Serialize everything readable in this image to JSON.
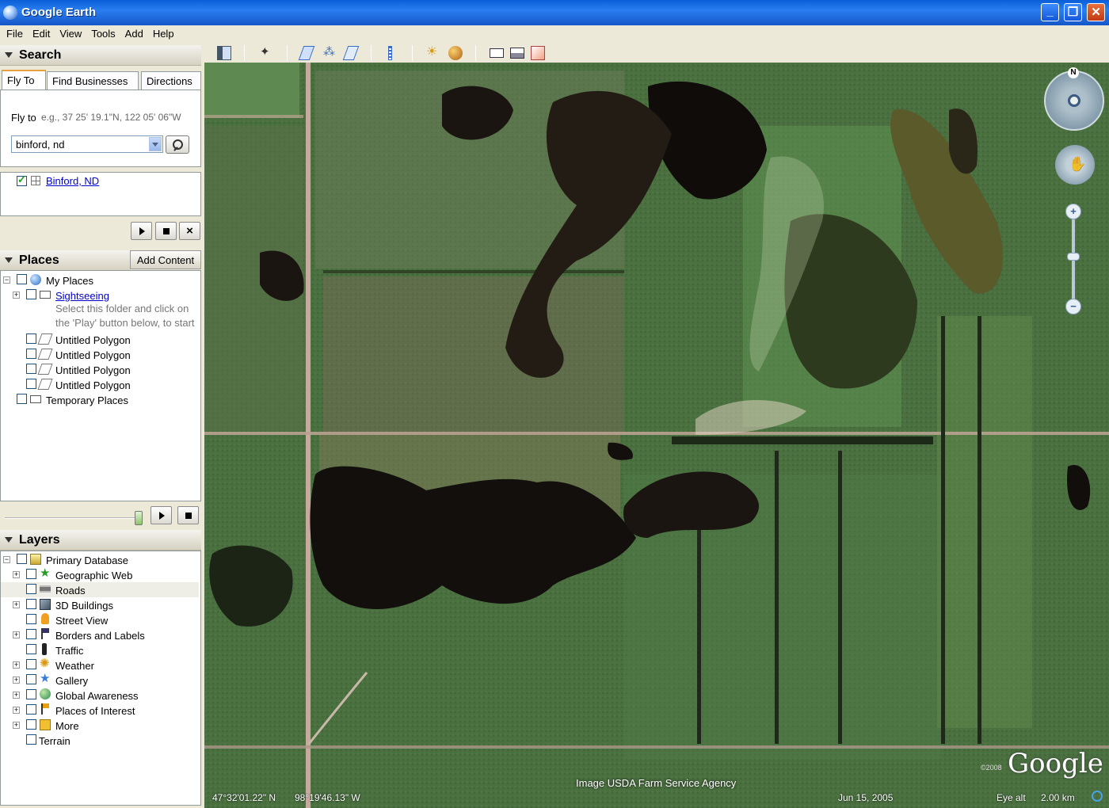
{
  "window": {
    "title": "Google Earth"
  },
  "menu": [
    "File",
    "Edit",
    "View",
    "Tools",
    "Add",
    "Help"
  ],
  "search": {
    "header": "Search",
    "tabs": [
      "Fly To",
      "Find Businesses",
      "Directions"
    ],
    "flyto_label": "Fly to",
    "flyto_hint": "e.g., 37 25' 19.1\"N, 122 05' 06\"W",
    "query": "binford, nd",
    "result": "Binford, ND"
  },
  "places": {
    "header": "Places",
    "add_content": "Add Content",
    "items": [
      {
        "label": "My Places"
      },
      {
        "label": "Sightseeing"
      },
      {
        "label": "Select this folder and click on"
      },
      {
        "label": "the 'Play' button below, to start"
      },
      {
        "label": "Untitled Polygon"
      },
      {
        "label": "Untitled Polygon"
      },
      {
        "label": "Untitled Polygon"
      },
      {
        "label": "Untitled Polygon"
      },
      {
        "label": "Temporary Places"
      }
    ]
  },
  "layers": {
    "header": "Layers",
    "items": [
      {
        "label": "Primary Database"
      },
      {
        "label": "Geographic Web"
      },
      {
        "label": "Roads"
      },
      {
        "label": "3D Buildings"
      },
      {
        "label": "Street View"
      },
      {
        "label": "Borders and Labels"
      },
      {
        "label": "Traffic"
      },
      {
        "label": "Weather"
      },
      {
        "label": "Gallery"
      },
      {
        "label": "Global Awareness"
      },
      {
        "label": "Places of Interest"
      },
      {
        "label": "More"
      },
      {
        "label": "Terrain"
      }
    ]
  },
  "map": {
    "imagery_credit": "Image USDA Farm Service Agency",
    "copyright": "©2008",
    "logo": "Google",
    "north_label": "N",
    "zoom_plus": "+",
    "zoom_minus": "−"
  },
  "status": {
    "lat": "47°32'01.22\" N",
    "lon": "98°19'46.13\" W",
    "date": "Jun 15, 2005",
    "eye_alt_label": "Eye alt",
    "eye_alt": "2.00 km"
  }
}
